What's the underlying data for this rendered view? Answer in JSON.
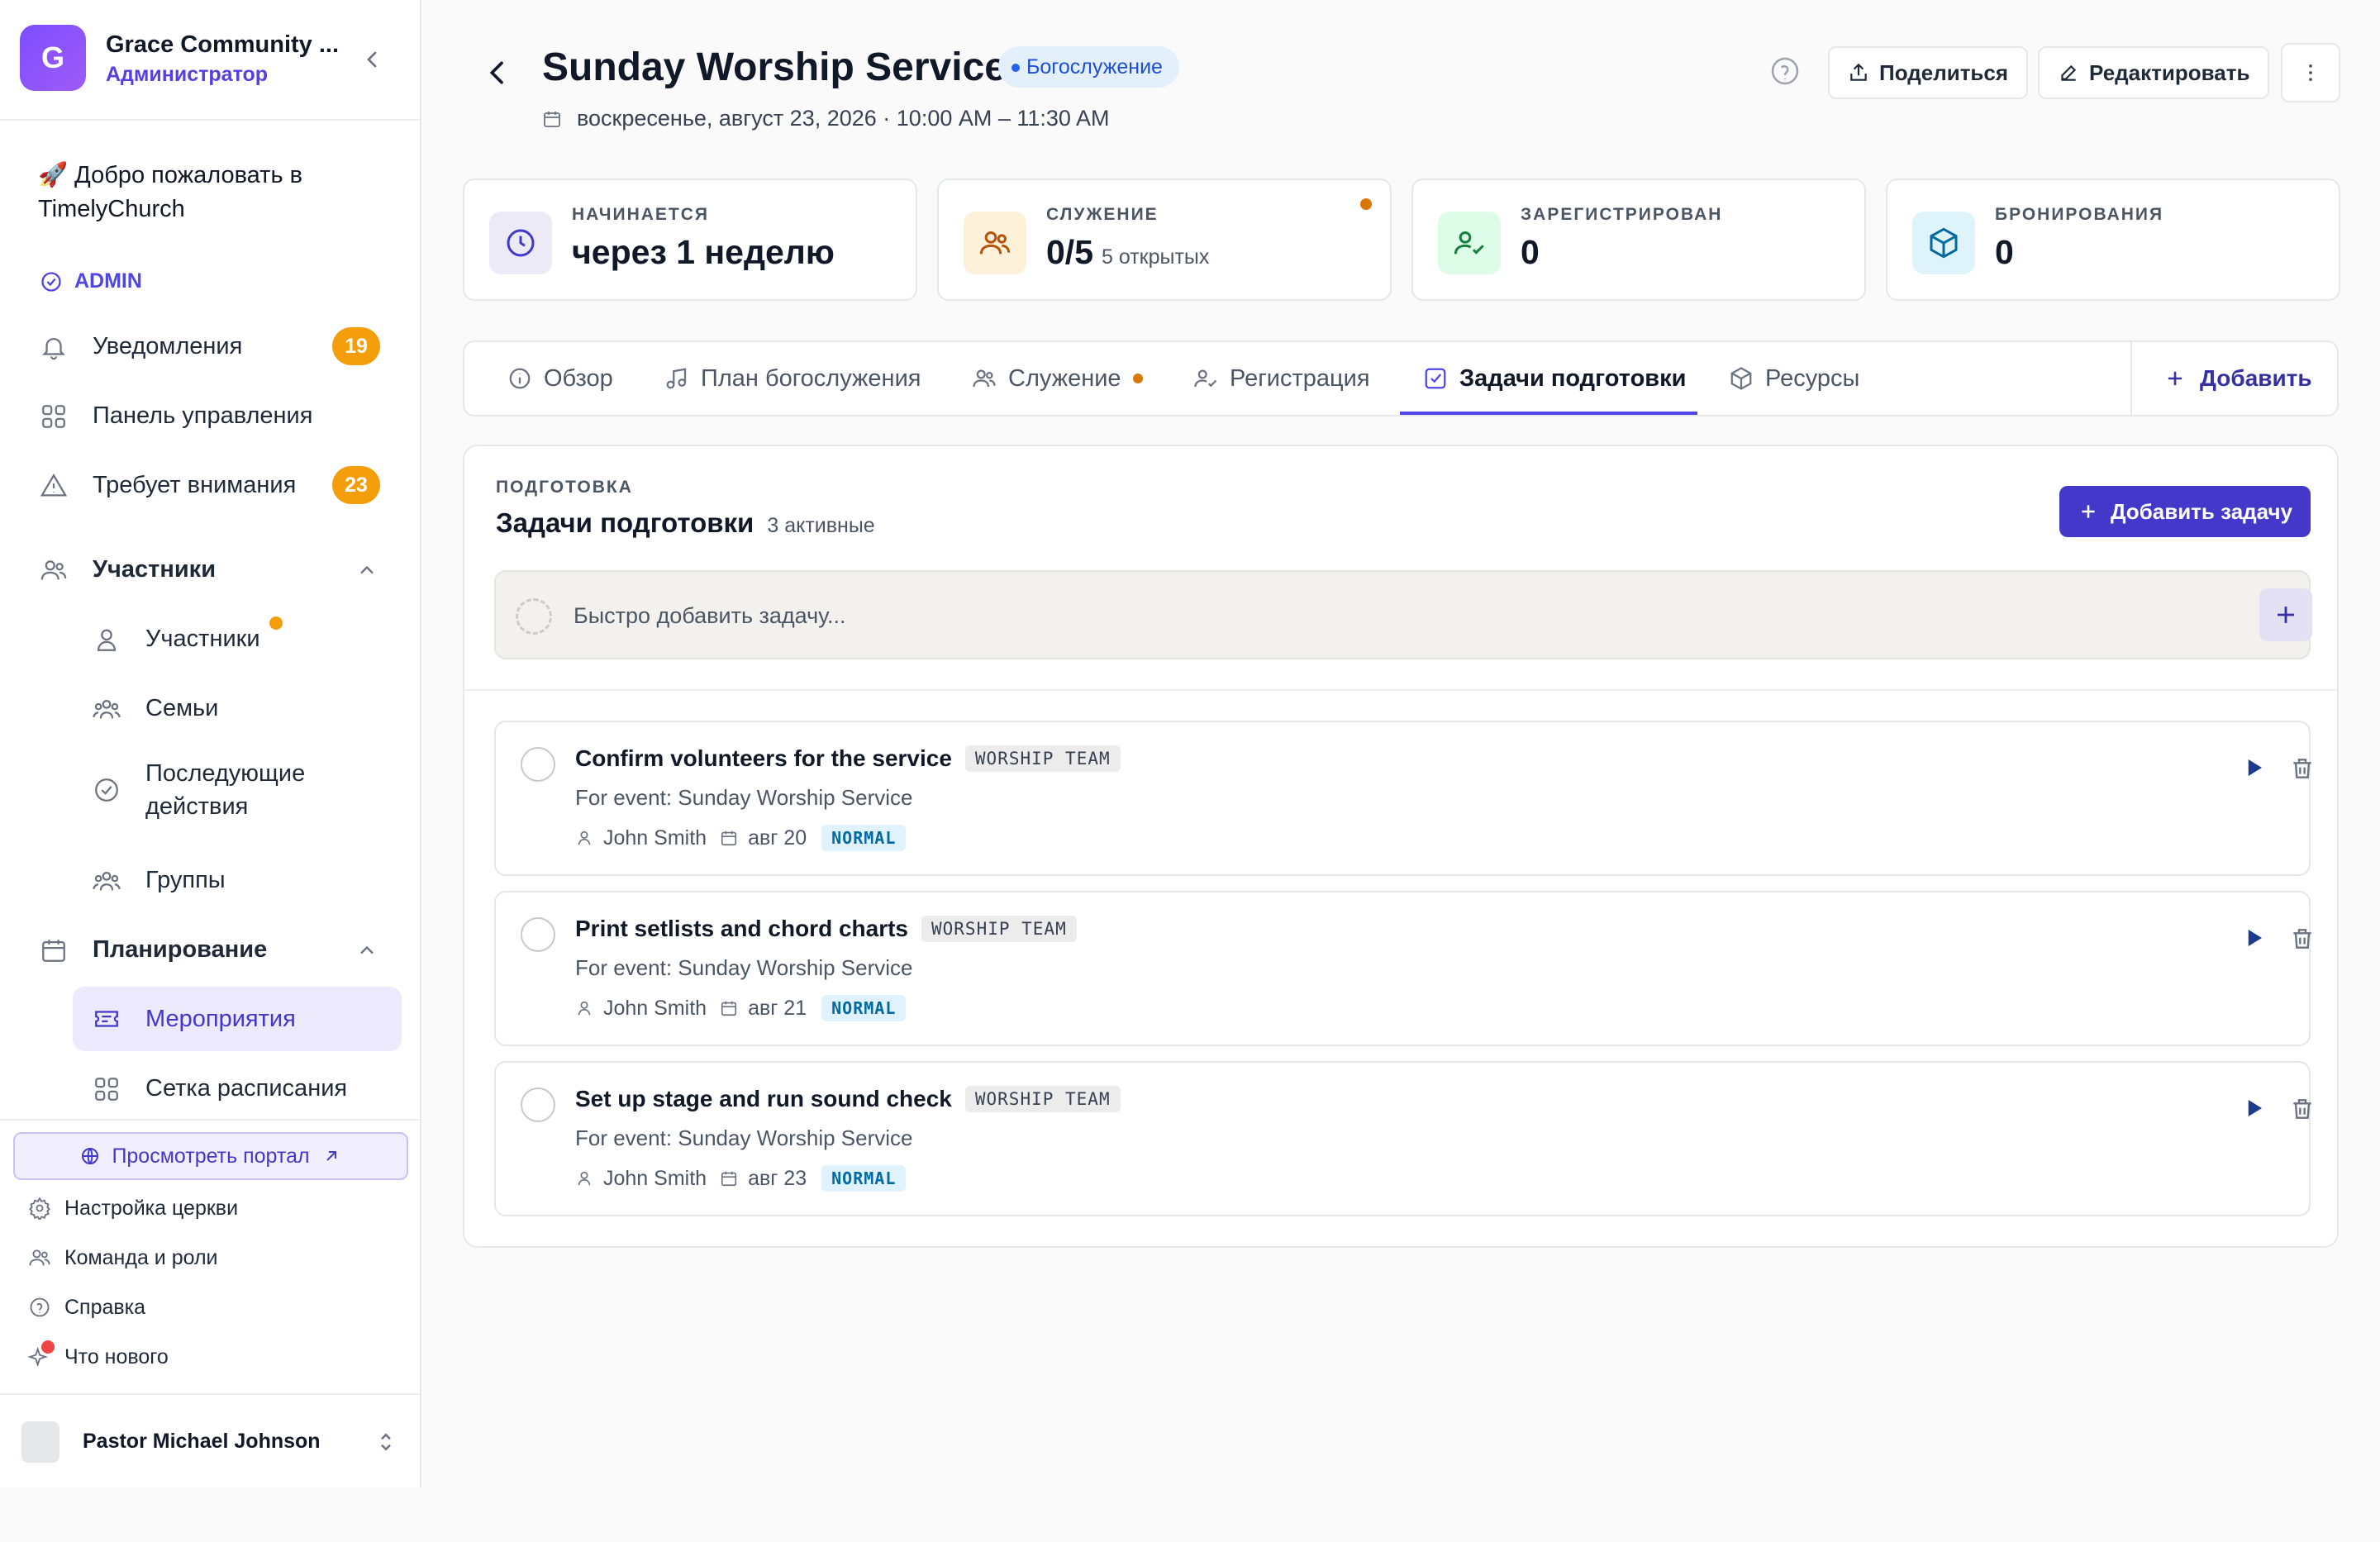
{
  "sidebar": {
    "org_initial": "G",
    "org_name": "Grace Community ...",
    "org_role": "Администратор",
    "welcome": "🚀 Добро пожаловать в TimelyChurch",
    "section_admin": "ADMIN",
    "items": [
      {
        "label": "Уведомления",
        "badge": "19",
        "icon": "bell-icon"
      },
      {
        "label": "Панель управления",
        "icon": "grid-icon"
      },
      {
        "label": "Требует внимания",
        "badge": "23",
        "icon": "alert-triangle-icon"
      }
    ],
    "group_people": {
      "label": "Участники",
      "icon": "users-icon"
    },
    "people_items": [
      {
        "label": "Участники",
        "icon": "user-icon"
      },
      {
        "label": "Семьи",
        "icon": "family-icon"
      },
      {
        "label": "Последующие действия",
        "icon": "check-circle-icon"
      },
      {
        "label": "Группы",
        "icon": "group-icon"
      }
    ],
    "group_planning": {
      "label": "Планирование",
      "icon": "calendar-icon"
    },
    "planning_items": [
      {
        "label": "Мероприятия",
        "icon": "ticket-icon",
        "active": true
      },
      {
        "label": "Сетка расписания",
        "icon": "grid-icon"
      }
    ],
    "portal_label": "Просмотреть портал",
    "footer_links": [
      {
        "label": "Настройка церкви",
        "icon": "gear-icon"
      },
      {
        "label": "Команда и роли",
        "icon": "users-icon"
      },
      {
        "label": "Справка",
        "icon": "help-circle-icon"
      },
      {
        "label": "Что нового",
        "icon": "sparkles-icon"
      }
    ],
    "user_name": "Pastor Michael Johnson"
  },
  "header": {
    "title": "Sunday Worship Service",
    "type_badge": "Богослужение",
    "datetime": "воскресенье, август 23, 2026 · 10:00 AM – 11:30 AM",
    "share_label": "Поделиться",
    "edit_label": "Редактировать"
  },
  "stats": [
    {
      "label": "НАЧИНАЕТСЯ",
      "value": "через 1 неделю",
      "sub": ""
    },
    {
      "label": "СЛУЖЕНИЕ",
      "value": "0/5",
      "sub": "5 открытых"
    },
    {
      "label": "ЗАРЕГИСТРИРОВАН",
      "value": "0",
      "sub": ""
    },
    {
      "label": "БРОНИРОВАНИЯ",
      "value": "0",
      "sub": ""
    }
  ],
  "tabs": [
    {
      "label": "Обзор"
    },
    {
      "label": "План богослужения"
    },
    {
      "label": "Служение"
    },
    {
      "label": "Регистрация"
    },
    {
      "label": "Задачи подготовки",
      "active": true
    },
    {
      "label": "Ресурсы"
    }
  ],
  "add_tab_label": "Добавить",
  "panel": {
    "eyebrow": "ПОДГОТОВКА",
    "title": "Задачи подготовки",
    "count": "3 активные",
    "add_button": "Добавить задачу",
    "quick_placeholder": "Быстро добавить задачу..."
  },
  "tasks": [
    {
      "title": "Confirm volunteers for the service",
      "tag": "WORSHIP TEAM",
      "sub": "For event: Sunday Worship Service",
      "assignee": "John Smith",
      "date": "авг 20",
      "priority": "NORMAL"
    },
    {
      "title": "Print setlists and chord charts",
      "tag": "WORSHIP TEAM",
      "sub": "For event: Sunday Worship Service",
      "assignee": "John Smith",
      "date": "авг 21",
      "priority": "NORMAL"
    },
    {
      "title": "Set up stage and run sound check",
      "tag": "WORSHIP TEAM",
      "sub": "For event: Sunday Worship Service",
      "assignee": "John Smith",
      "date": "авг 23",
      "priority": "NORMAL"
    }
  ],
  "colors": {
    "accent": "#4338ca",
    "badge": "#f59e0b",
    "type_badge_bg": "#e3f0fb"
  }
}
